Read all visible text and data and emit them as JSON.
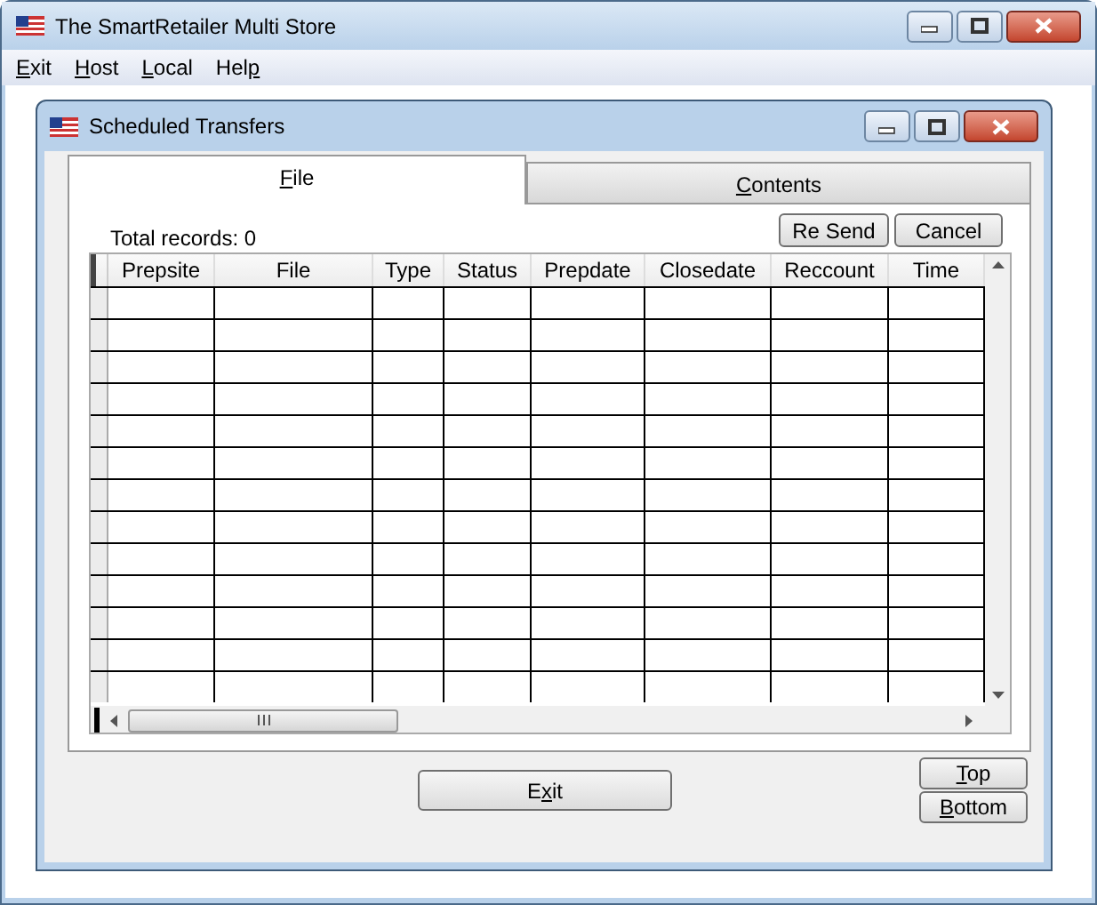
{
  "window": {
    "title": "The SmartRetailer Multi Store"
  },
  "menu": [
    {
      "key": "E",
      "after": "xit"
    },
    {
      "key": "H",
      "after": "ost"
    },
    {
      "key": "L",
      "after": "ocal"
    },
    {
      "before": "Hel",
      "key": "p"
    }
  ],
  "child_window": {
    "title": "Scheduled Transfers"
  },
  "tabs": [
    {
      "key": "F",
      "after": "ile",
      "selected": true
    },
    {
      "key": "C",
      "after": "ontents",
      "selected": false
    }
  ],
  "total_records": "Total records: 0",
  "buttons": [
    {
      "label": "Re Send"
    },
    {
      "label": "Cancel"
    }
  ],
  "table": {
    "columns": [
      "Prepsite",
      "File",
      "Type",
      "Status",
      "Prepdate",
      "Closedate",
      "Reccount",
      "Time"
    ]
  },
  "exit_button": {
    "before": "E",
    "key": "x",
    "after": "it"
  },
  "nav_buttons": [
    {
      "key": "T",
      "after": "op"
    },
    {
      "key": "B",
      "after": "ottom"
    }
  ]
}
